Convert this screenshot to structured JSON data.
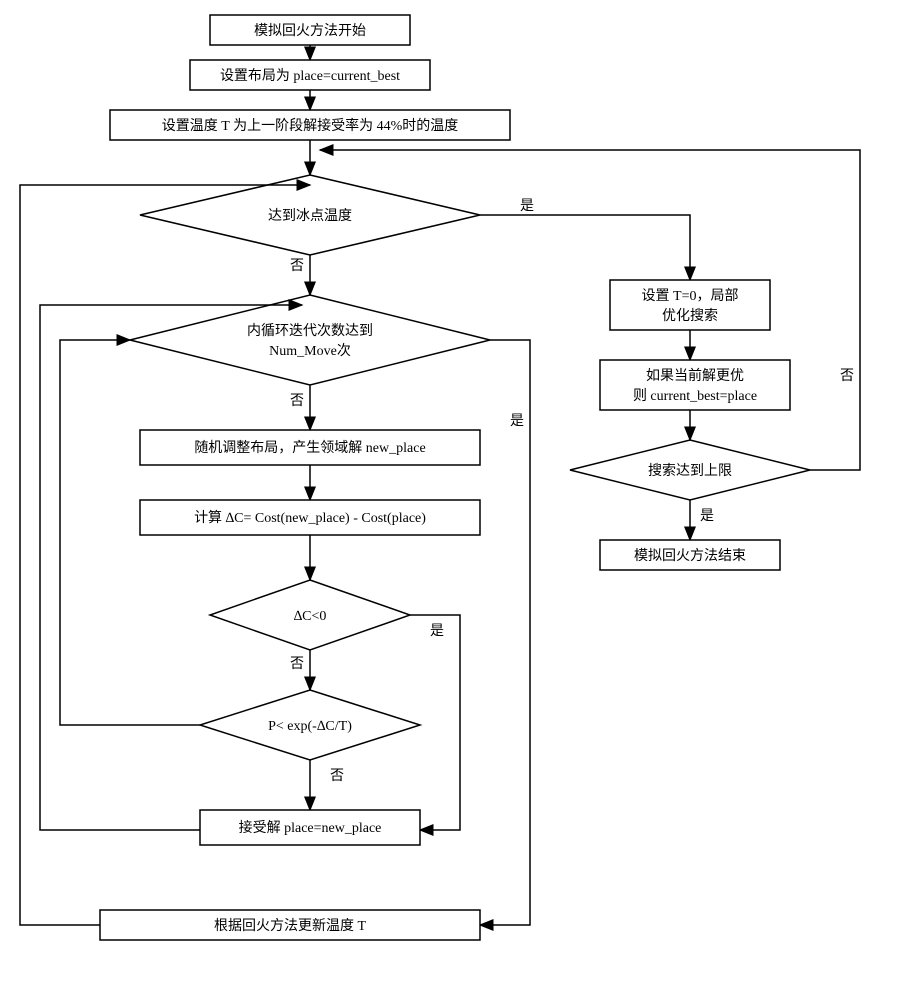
{
  "nodes": {
    "start": "模拟回火方法开始",
    "set_place": "设置布局为 place=current_best",
    "set_temp": "设置温度 T 为上一阶段解接受率为 44%时的温度",
    "freeze_check": "达到冰点温度",
    "inner_loop_check_l1": "内循环迭代次数达到",
    "inner_loop_check_l2": "Num_Move次",
    "random_adjust": "随机调整布局，产生领域解 new_place",
    "calc_delta": "计算 ∆C= Cost(new_place) - Cost(place)",
    "delta_check": "∆C<0",
    "prob_check": "P< exp(-∆C/T)",
    "accept": "接受解 place=new_place",
    "update_temp": "根据回火方法更新温度 T",
    "set_t0_l1": "设置 T=0，局部",
    "set_t0_l2": "优化搜索",
    "update_best_l1": "如果当前解更优",
    "update_best_l2": "则 current_best=place",
    "search_limit": "搜索达到上限",
    "end": "模拟回火方法结束"
  },
  "labels": {
    "yes": "是",
    "no": "否"
  }
}
